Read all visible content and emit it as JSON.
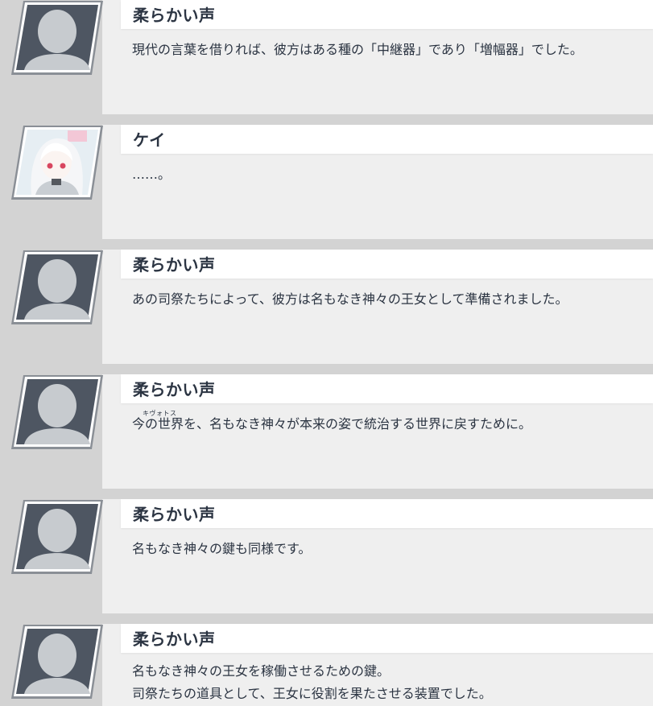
{
  "messages": [
    {
      "speaker": "柔らかい声",
      "portrait": "silhouette-icon",
      "text": "現代の言葉を借りれば、彼方はある種の「中継器」であり「増幅器」でした。"
    },
    {
      "speaker": "ケイ",
      "portrait": "kei-character-icon",
      "text": "……。"
    },
    {
      "speaker": "柔らかい声",
      "portrait": "silhouette-icon",
      "text": "あの司祭たちによって、彼方は名もなき神々の王女として準備されました。"
    },
    {
      "speaker": "柔らかい声",
      "portrait": "silhouette-icon",
      "ruby": "キヴォトス",
      "text": "今の世界を、名もなき神々が本来の姿で統治する世界に戻すために。"
    },
    {
      "speaker": "柔らかい声",
      "portrait": "silhouette-icon",
      "text": "名もなき神々の鍵も同様です。"
    },
    {
      "speaker": "柔らかい声",
      "portrait": "silhouette-icon",
      "text": "名もなき神々の王女を稼働させるための鍵。\n司祭たちの道具として、王女に役割を果たさせる装置でした。"
    }
  ]
}
